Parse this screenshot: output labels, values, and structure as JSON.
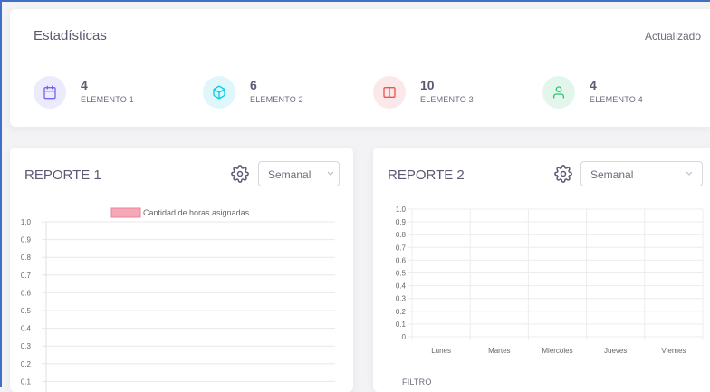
{
  "stats": {
    "title": "Estadísticas",
    "updated": "Actualizado",
    "items": [
      {
        "value": "4",
        "label": "ELEMENTO 1",
        "icon": "calendar-icon",
        "color": "#7367f0",
        "bg": "#ecebfd"
      },
      {
        "value": "6",
        "label": "ELEMENTO 2",
        "icon": "box-icon",
        "color": "#00cfe8",
        "bg": "#dff7fb"
      },
      {
        "value": "10",
        "label": "ELEMENTO 3",
        "icon": "book-icon",
        "color": "#ea5455",
        "bg": "#fce8e8"
      },
      {
        "value": "4",
        "label": "ELEMENTO 4",
        "icon": "user-icon",
        "color": "#28c76f",
        "bg": "#e3f6ec"
      }
    ]
  },
  "report1": {
    "title": "REPORTE 1",
    "select_value": "Semanal",
    "gear_icon": "gear-icon"
  },
  "report2": {
    "title": "REPORTE 2",
    "select_value": "Semanal",
    "gear_icon": "gear-icon",
    "filter_label": "FILTRO"
  },
  "chart_data": [
    {
      "type": "bar",
      "legend": [
        "Cantidad de horas asignadas"
      ],
      "legend_placement": "top",
      "series": [
        {
          "name": "Cantidad de horas asignadas",
          "color": "#f7a8b8",
          "values": []
        }
      ],
      "y_ticks": [
        "1.0",
        "0.9",
        "0.8",
        "0.7",
        "0.6",
        "0.5",
        "0.4",
        "0.3",
        "0.2",
        "0.1"
      ],
      "ylim": [
        0,
        1
      ],
      "grid": true
    },
    {
      "type": "bar",
      "categories": [
        "Lunes",
        "Martes",
        "Miercoles",
        "Jueves",
        "Viernes"
      ],
      "series": [],
      "y_ticks": [
        "1.0",
        "0.9",
        "0.8",
        "0.7",
        "0.6",
        "0.5",
        "0.4",
        "0.3",
        "0.2",
        "0.1",
        "0"
      ],
      "ylim": [
        0,
        1
      ],
      "grid": true
    }
  ]
}
